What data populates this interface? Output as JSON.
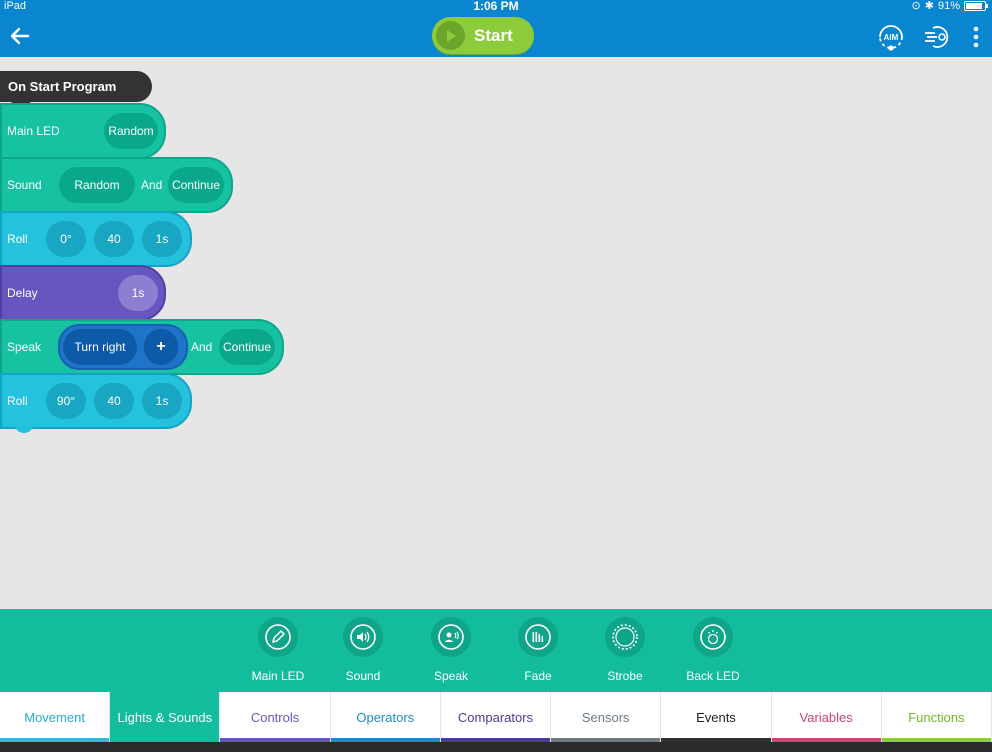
{
  "status": {
    "device": "iPad",
    "time": "1:06 PM",
    "battery": "91%"
  },
  "toolbar": {
    "start_label": "Start"
  },
  "program": {
    "header": "On Start Program",
    "main_led": {
      "label": "Main LED",
      "value": "Random"
    },
    "sound": {
      "label": "Sound",
      "value": "Random",
      "and": "And",
      "mode": "Continue"
    },
    "roll1": {
      "label": "Roll",
      "heading": "0°",
      "speed": "40",
      "duration": "1s"
    },
    "delay": {
      "label": "Delay",
      "duration": "1s"
    },
    "speak": {
      "label": "Speak",
      "text": "Turn right",
      "plus": "+",
      "and": "And",
      "mode": "Continue"
    },
    "roll2": {
      "label": "Roll",
      "heading": "90°",
      "speed": "40",
      "duration": "1s"
    }
  },
  "palette": [
    {
      "label": "Main LED",
      "icon": "pencil-icon"
    },
    {
      "label": "Sound",
      "icon": "speaker-icon"
    },
    {
      "label": "Speak",
      "icon": "speaking-person-icon"
    },
    {
      "label": "Fade",
      "icon": "fade-bars-icon"
    },
    {
      "label": "Strobe",
      "icon": "strobe-icon"
    },
    {
      "label": "Back LED",
      "icon": "back-led-icon"
    }
  ],
  "tabs": [
    {
      "label": "Movement",
      "color": "#3ab7d8",
      "text_color": "#27a9d6"
    },
    {
      "label": "Lights & Sounds",
      "color": "#14bc9e",
      "text_color": "#ffffff",
      "active": true
    },
    {
      "label": "Controls",
      "color": "#6656bf",
      "text_color": "#6656bf"
    },
    {
      "label": "Operators",
      "color": "#1e88c8",
      "text_color": "#1e88c8"
    },
    {
      "label": "Comparators",
      "color": "#4b3a9a",
      "text_color": "#4b3a9a"
    },
    {
      "label": "Sensors",
      "color": "#6e7b85",
      "text_color": "#6e7b85"
    },
    {
      "label": "Events",
      "color": "#333333",
      "text_color": "#222222"
    },
    {
      "label": "Variables",
      "color": "#d04377",
      "text_color": "#d04377"
    },
    {
      "label": "Functions",
      "color": "#8ccc3c",
      "text_color": "#74b42a"
    }
  ]
}
